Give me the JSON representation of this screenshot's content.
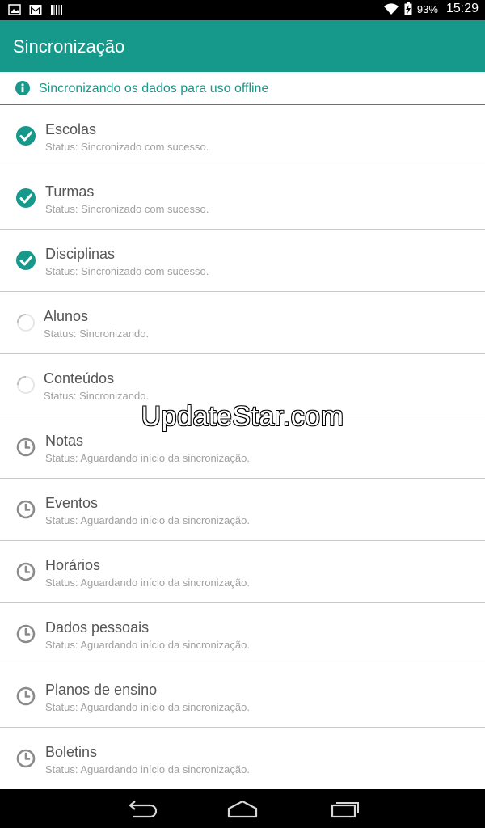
{
  "status_bar": {
    "battery": "93%",
    "time": "15:29",
    "icons": [
      "image-icon",
      "gmail-icon",
      "barcode-icon",
      "wifi-icon",
      "battery-charging-icon"
    ]
  },
  "app_bar": {
    "title": "Sincronização"
  },
  "info_banner": {
    "text": "Sincronizando os dados para uso offline",
    "icon": "info-icon"
  },
  "items": [
    {
      "name": "Escolas",
      "status": "Status: Sincronizado com sucesso.",
      "state": "done"
    },
    {
      "name": "Turmas",
      "status": "Status: Sincronizado com sucesso.",
      "state": "done"
    },
    {
      "name": "Disciplinas",
      "status": "Status: Sincronizado com sucesso.",
      "state": "done"
    },
    {
      "name": "Alunos",
      "status": "Status: Sincronizando.",
      "state": "syncing"
    },
    {
      "name": "Conteúdos",
      "status": "Status: Sincronizando.",
      "state": "syncing"
    },
    {
      "name": "Notas",
      "status": "Status: Aguardando início da sincronização.",
      "state": "waiting"
    },
    {
      "name": "Eventos",
      "status": "Status: Aguardando início da sincronização.",
      "state": "waiting"
    },
    {
      "name": "Horários",
      "status": "Status: Aguardando início da sincronização.",
      "state": "waiting"
    },
    {
      "name": "Dados pessoais",
      "status": "Status: Aguardando início da sincronização.",
      "state": "waiting"
    },
    {
      "name": "Planos de ensino",
      "status": "Status: Aguardando início da sincronização.",
      "state": "waiting"
    },
    {
      "name": "Boletins",
      "status": "Status: Aguardando início da sincronização.",
      "state": "waiting"
    }
  ],
  "watermark": "UpdateStar.com",
  "colors": {
    "accent": "#16998a",
    "divider": "#c8c8c8",
    "icon_gray": "#8a8a8a"
  }
}
